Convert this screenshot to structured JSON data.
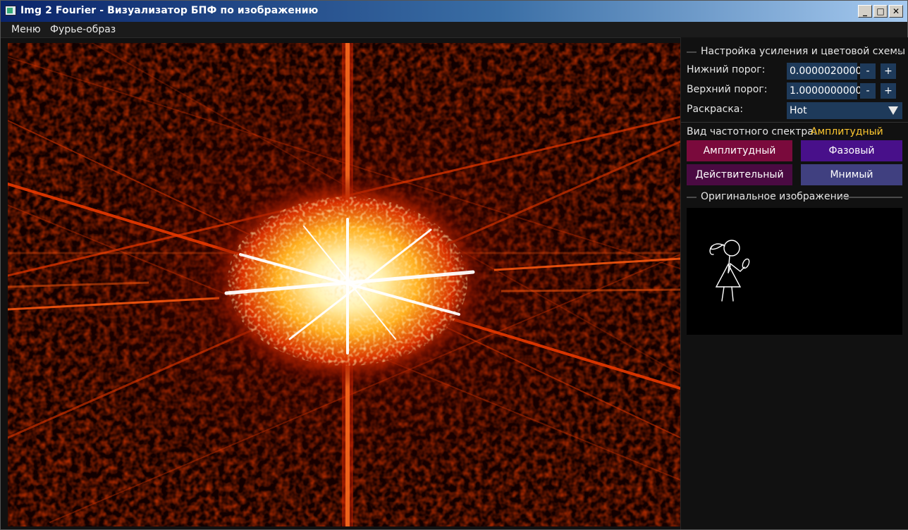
{
  "window": {
    "title": "Img 2 Fourier - Визуализатор БПФ по изображению",
    "controls": {
      "minimize": "_",
      "maximize": "□",
      "close": "✕"
    }
  },
  "menu": [
    "Меню",
    "Фурье-образ"
  ],
  "gain": {
    "title": "Настройка усиления и цветовой схемы",
    "lower_label": "Нижний порог:",
    "lower_value": "0.0000020000",
    "upper_label": "Верхний порог:",
    "upper_value": "1.0000000000",
    "dec": "-",
    "inc": "+",
    "colormap_label": "Раскраска:",
    "colormap_value": "Hot"
  },
  "spectrum_view": {
    "label": "Вид частотного спектра:",
    "current": "Амплитудный",
    "current_color": "#ffc830",
    "buttons": [
      {
        "label": "Амплитудный",
        "color": "#7a0a3c"
      },
      {
        "label": "Фазовый",
        "color": "#48108a"
      },
      {
        "label": "Действительный",
        "color": "#4a0a42"
      },
      {
        "label": "Мнимый",
        "color": "#404080"
      }
    ]
  },
  "original": {
    "title": "Оригинальное изображение"
  },
  "icons": [
    "app-icon",
    "minimize-icon",
    "maximize-icon",
    "close-icon",
    "dropdown-arrow-icon"
  ]
}
